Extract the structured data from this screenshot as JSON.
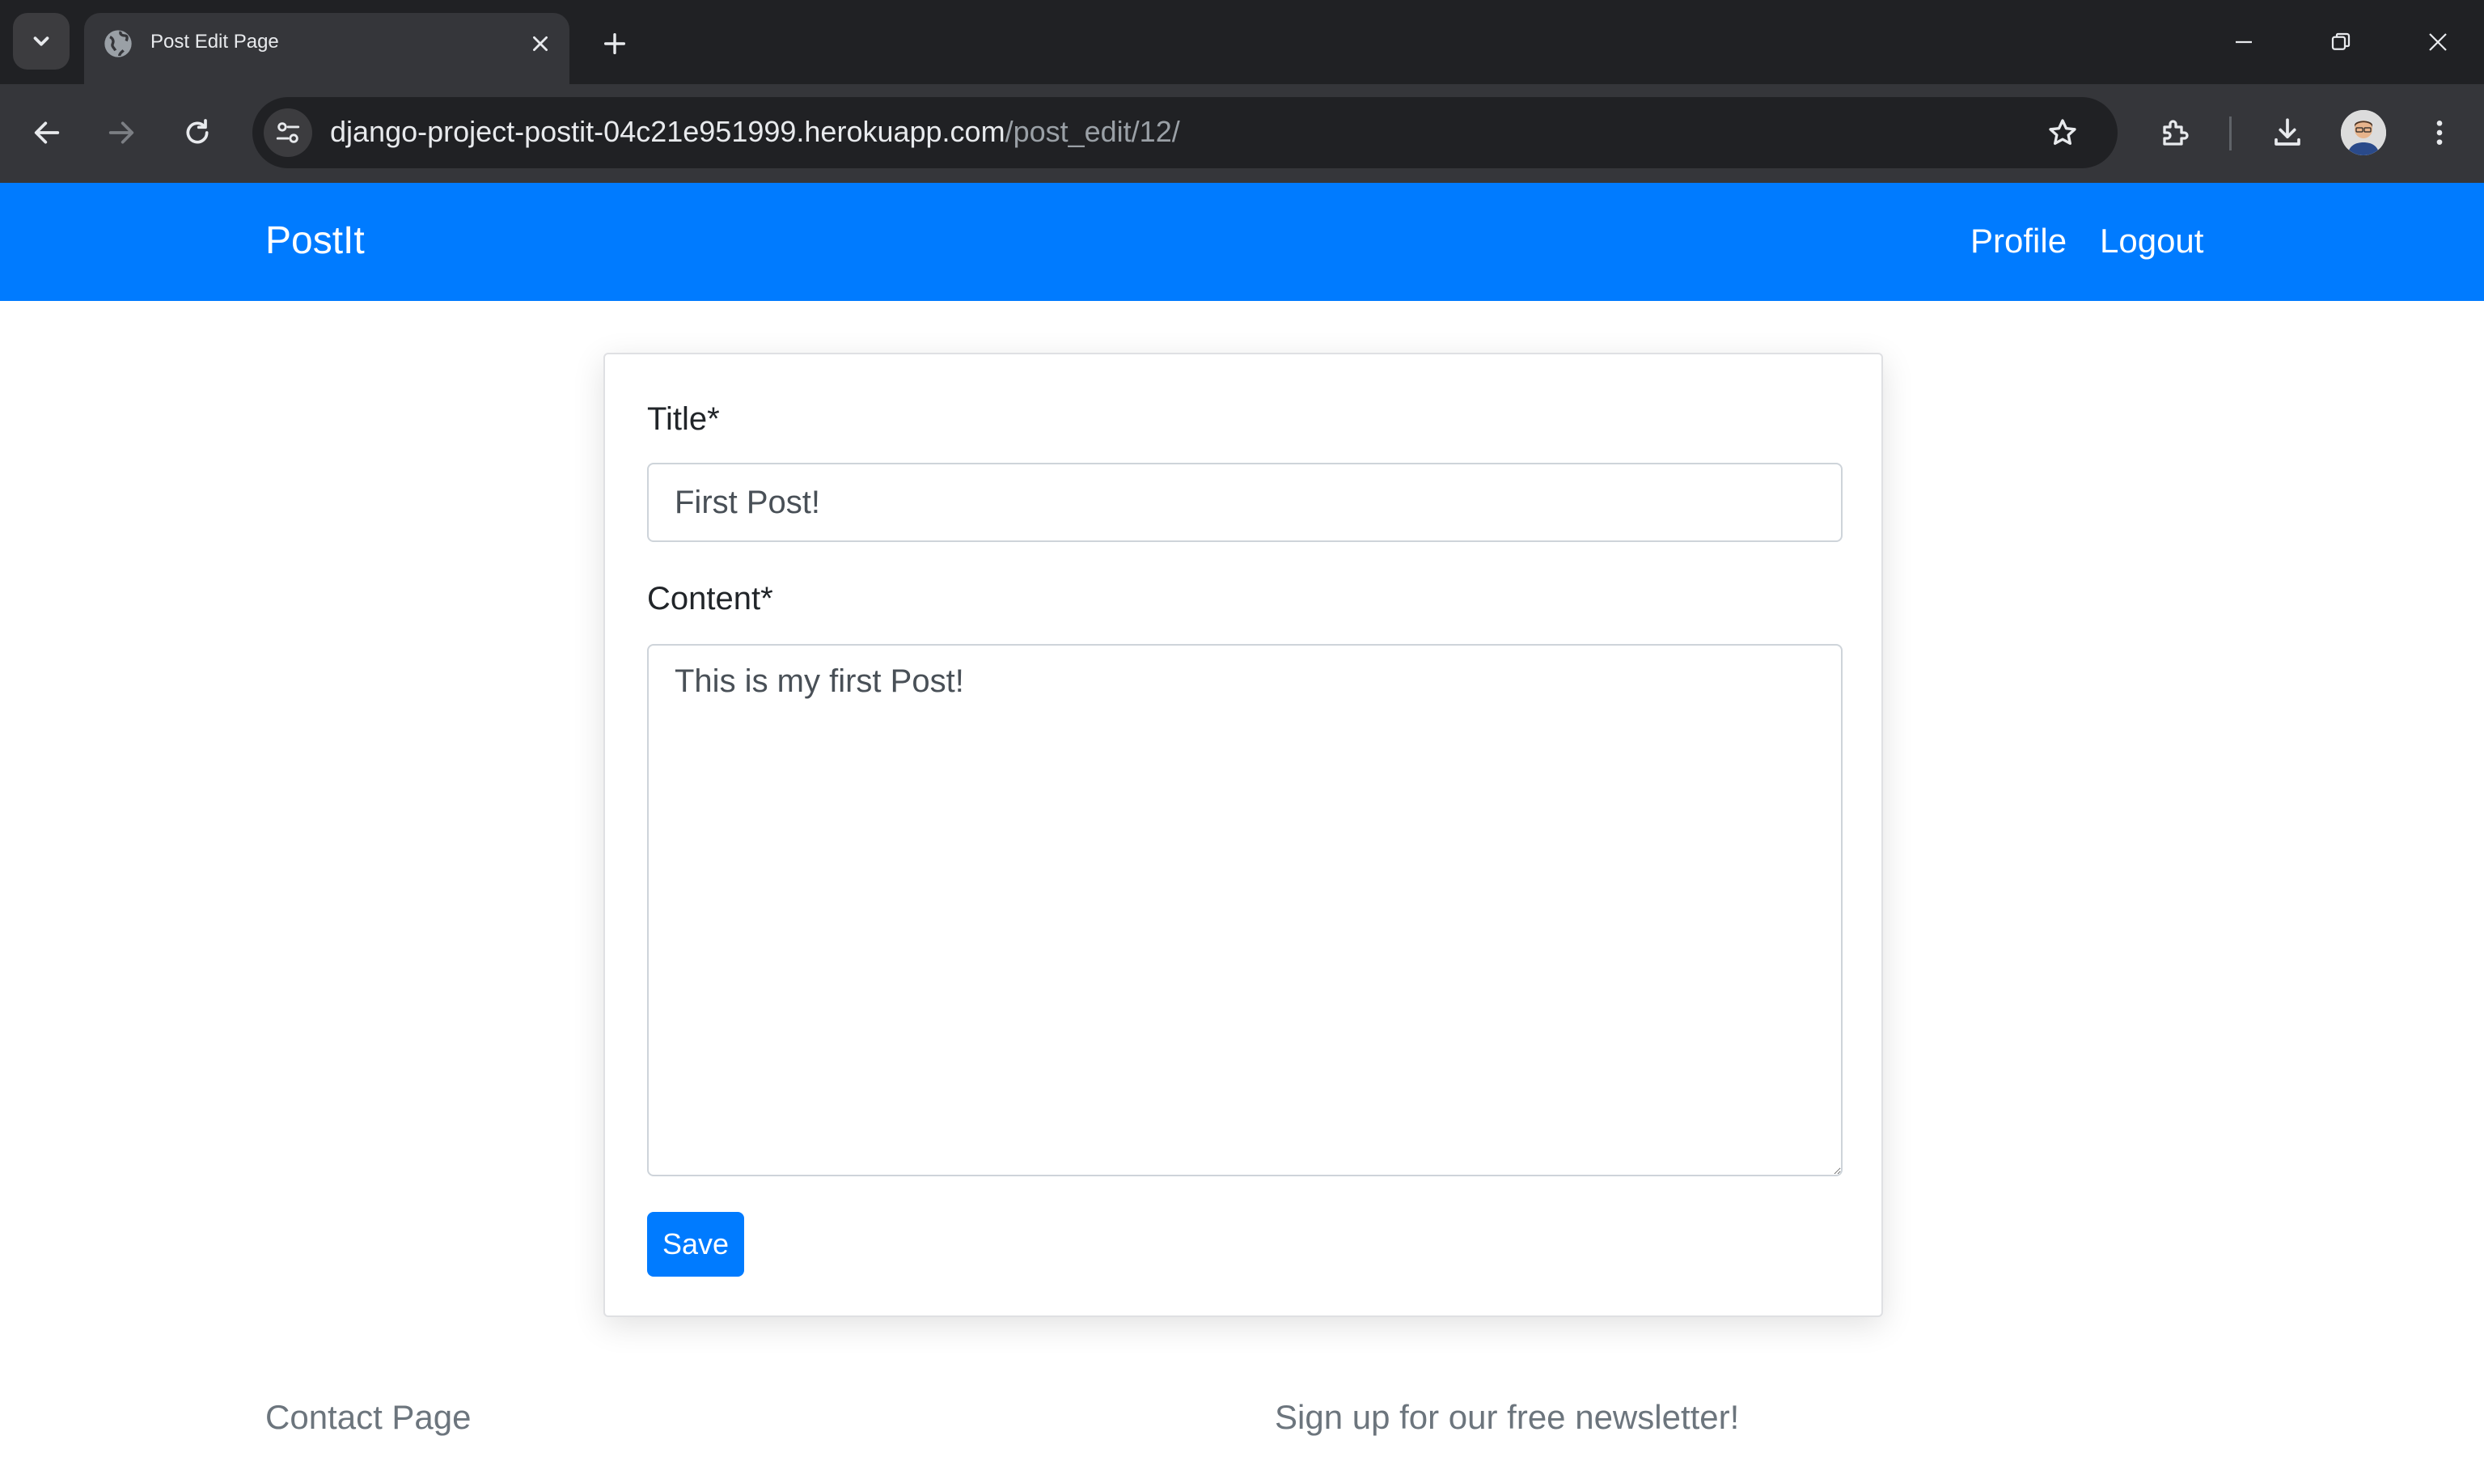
{
  "browser": {
    "tab": {
      "title": "Post Edit Page"
    },
    "omnibox": {
      "host": "django-project-postit-04c21e951999.herokuapp.com",
      "path": "/post_edit/12/"
    },
    "icons": {
      "tab_search": "chevron-down-icon",
      "favicon": "globe-icon",
      "tab_close": "close-icon",
      "new_tab": "plus-icon",
      "minimize": "minimize-icon",
      "restore": "restore-icon",
      "close_window": "close-icon",
      "back": "arrow-left-icon",
      "forward": "arrow-right-icon",
      "reload": "reload-icon",
      "site_info": "tune-icon",
      "bookmark": "star-icon",
      "extensions": "puzzle-icon",
      "downloads": "download-icon",
      "menu": "kebab-menu-icon"
    }
  },
  "navbar": {
    "brand": "PostIt",
    "links": [
      "Profile",
      "Logout"
    ],
    "color": "#007bff"
  },
  "form": {
    "title_label": "Title*",
    "title_value": "First Post!",
    "content_label": "Content*",
    "content_value": "This is my first Post!",
    "save_label": "Save"
  },
  "footer": {
    "contact": "Contact Page",
    "newsletter": "Sign up for our free newsletter!"
  }
}
